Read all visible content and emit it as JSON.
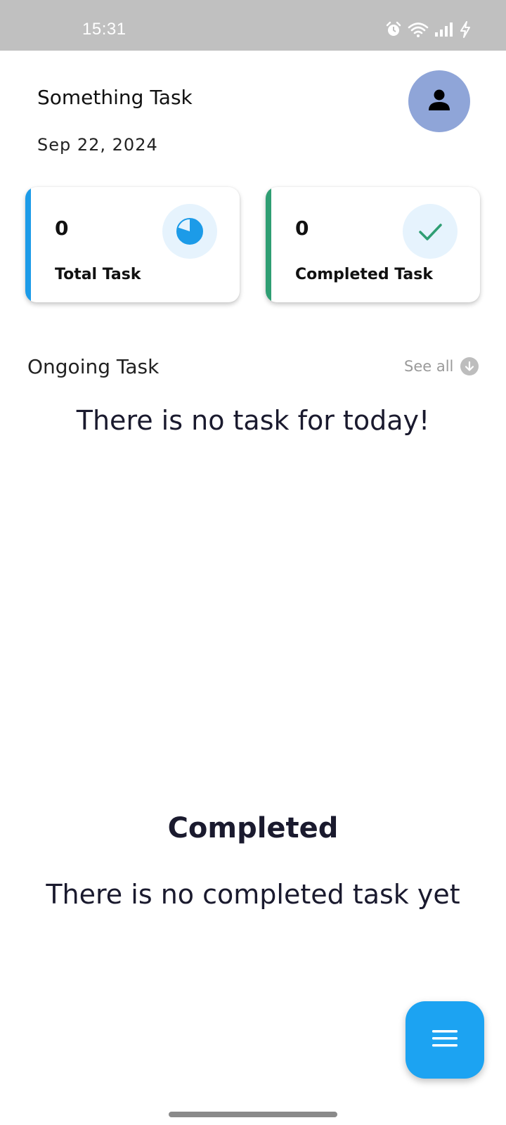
{
  "status_bar": {
    "time": "15:31",
    "icons": [
      "alarm-icon",
      "wifi-icon",
      "signal-icon",
      "charging-icon"
    ],
    "background": "#c0c0c0"
  },
  "header": {
    "title": "Something Task",
    "date": "Sep 22, 2024",
    "avatar_icon": "person-icon",
    "avatar_color": "#8fa5d8"
  },
  "stats": {
    "total": {
      "value": "0",
      "label": "Total Task",
      "icon": "pie-chart-icon",
      "accent": "#1c9be8"
    },
    "completed": {
      "value": "0",
      "label": "Completed Task",
      "icon": "checkmark-icon",
      "accent": "#2f9e73"
    }
  },
  "ongoing": {
    "title": "Ongoing Task",
    "see_all": "See all",
    "see_all_icon": "arrow-down-circle-icon",
    "empty_message": "There is no task for today!"
  },
  "completed_section": {
    "title": "Completed",
    "empty_message": "There is no completed task yet"
  },
  "fab": {
    "icon": "menu-icon",
    "color": "#1ca3f2"
  }
}
